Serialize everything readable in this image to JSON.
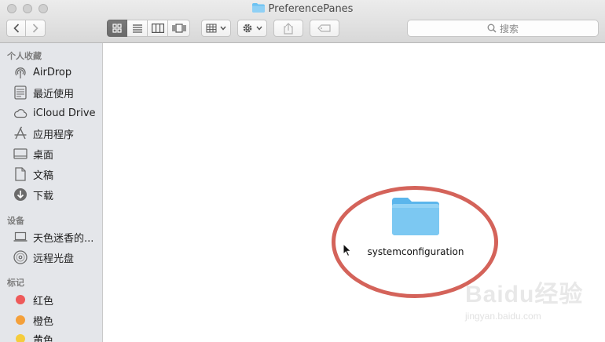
{
  "window": {
    "title": "PreferencePanes"
  },
  "toolbar": {
    "search_placeholder": "搜索"
  },
  "sidebar": {
    "favorites_header": "个人收藏",
    "favorites": [
      {
        "label": "AirDrop",
        "icon": "airdrop-icon"
      },
      {
        "label": "最近使用",
        "icon": "recents-icon"
      },
      {
        "label": "iCloud Drive",
        "icon": "cloud-icon"
      },
      {
        "label": "应用程序",
        "icon": "applications-icon"
      },
      {
        "label": "桌面",
        "icon": "desktop-icon"
      },
      {
        "label": "文稿",
        "icon": "documents-icon"
      },
      {
        "label": "下载",
        "icon": "downloads-icon"
      }
    ],
    "devices_header": "设备",
    "devices": [
      {
        "label": "天色迷香的...",
        "icon": "laptop-icon"
      },
      {
        "label": "远程光盘",
        "icon": "disc-icon"
      }
    ],
    "tags_header": "标记",
    "tags": [
      {
        "label": "红色",
        "color": "#ee5a5a"
      },
      {
        "label": "橙色",
        "color": "#f4a03a"
      },
      {
        "label": "黄色",
        "color": "#f5cc3c"
      }
    ]
  },
  "content": {
    "items": [
      {
        "name": "systemconfiguration",
        "icon": "folder-icon"
      }
    ]
  },
  "annotation": {
    "ellipse_color": "#d4635a"
  },
  "watermark": {
    "brand": "Baidu经验",
    "url": "jingyan.baidu.com"
  },
  "colors": {
    "folder_blue": "#6cc2f2",
    "sidebar_bg": "#e4e6ea"
  }
}
